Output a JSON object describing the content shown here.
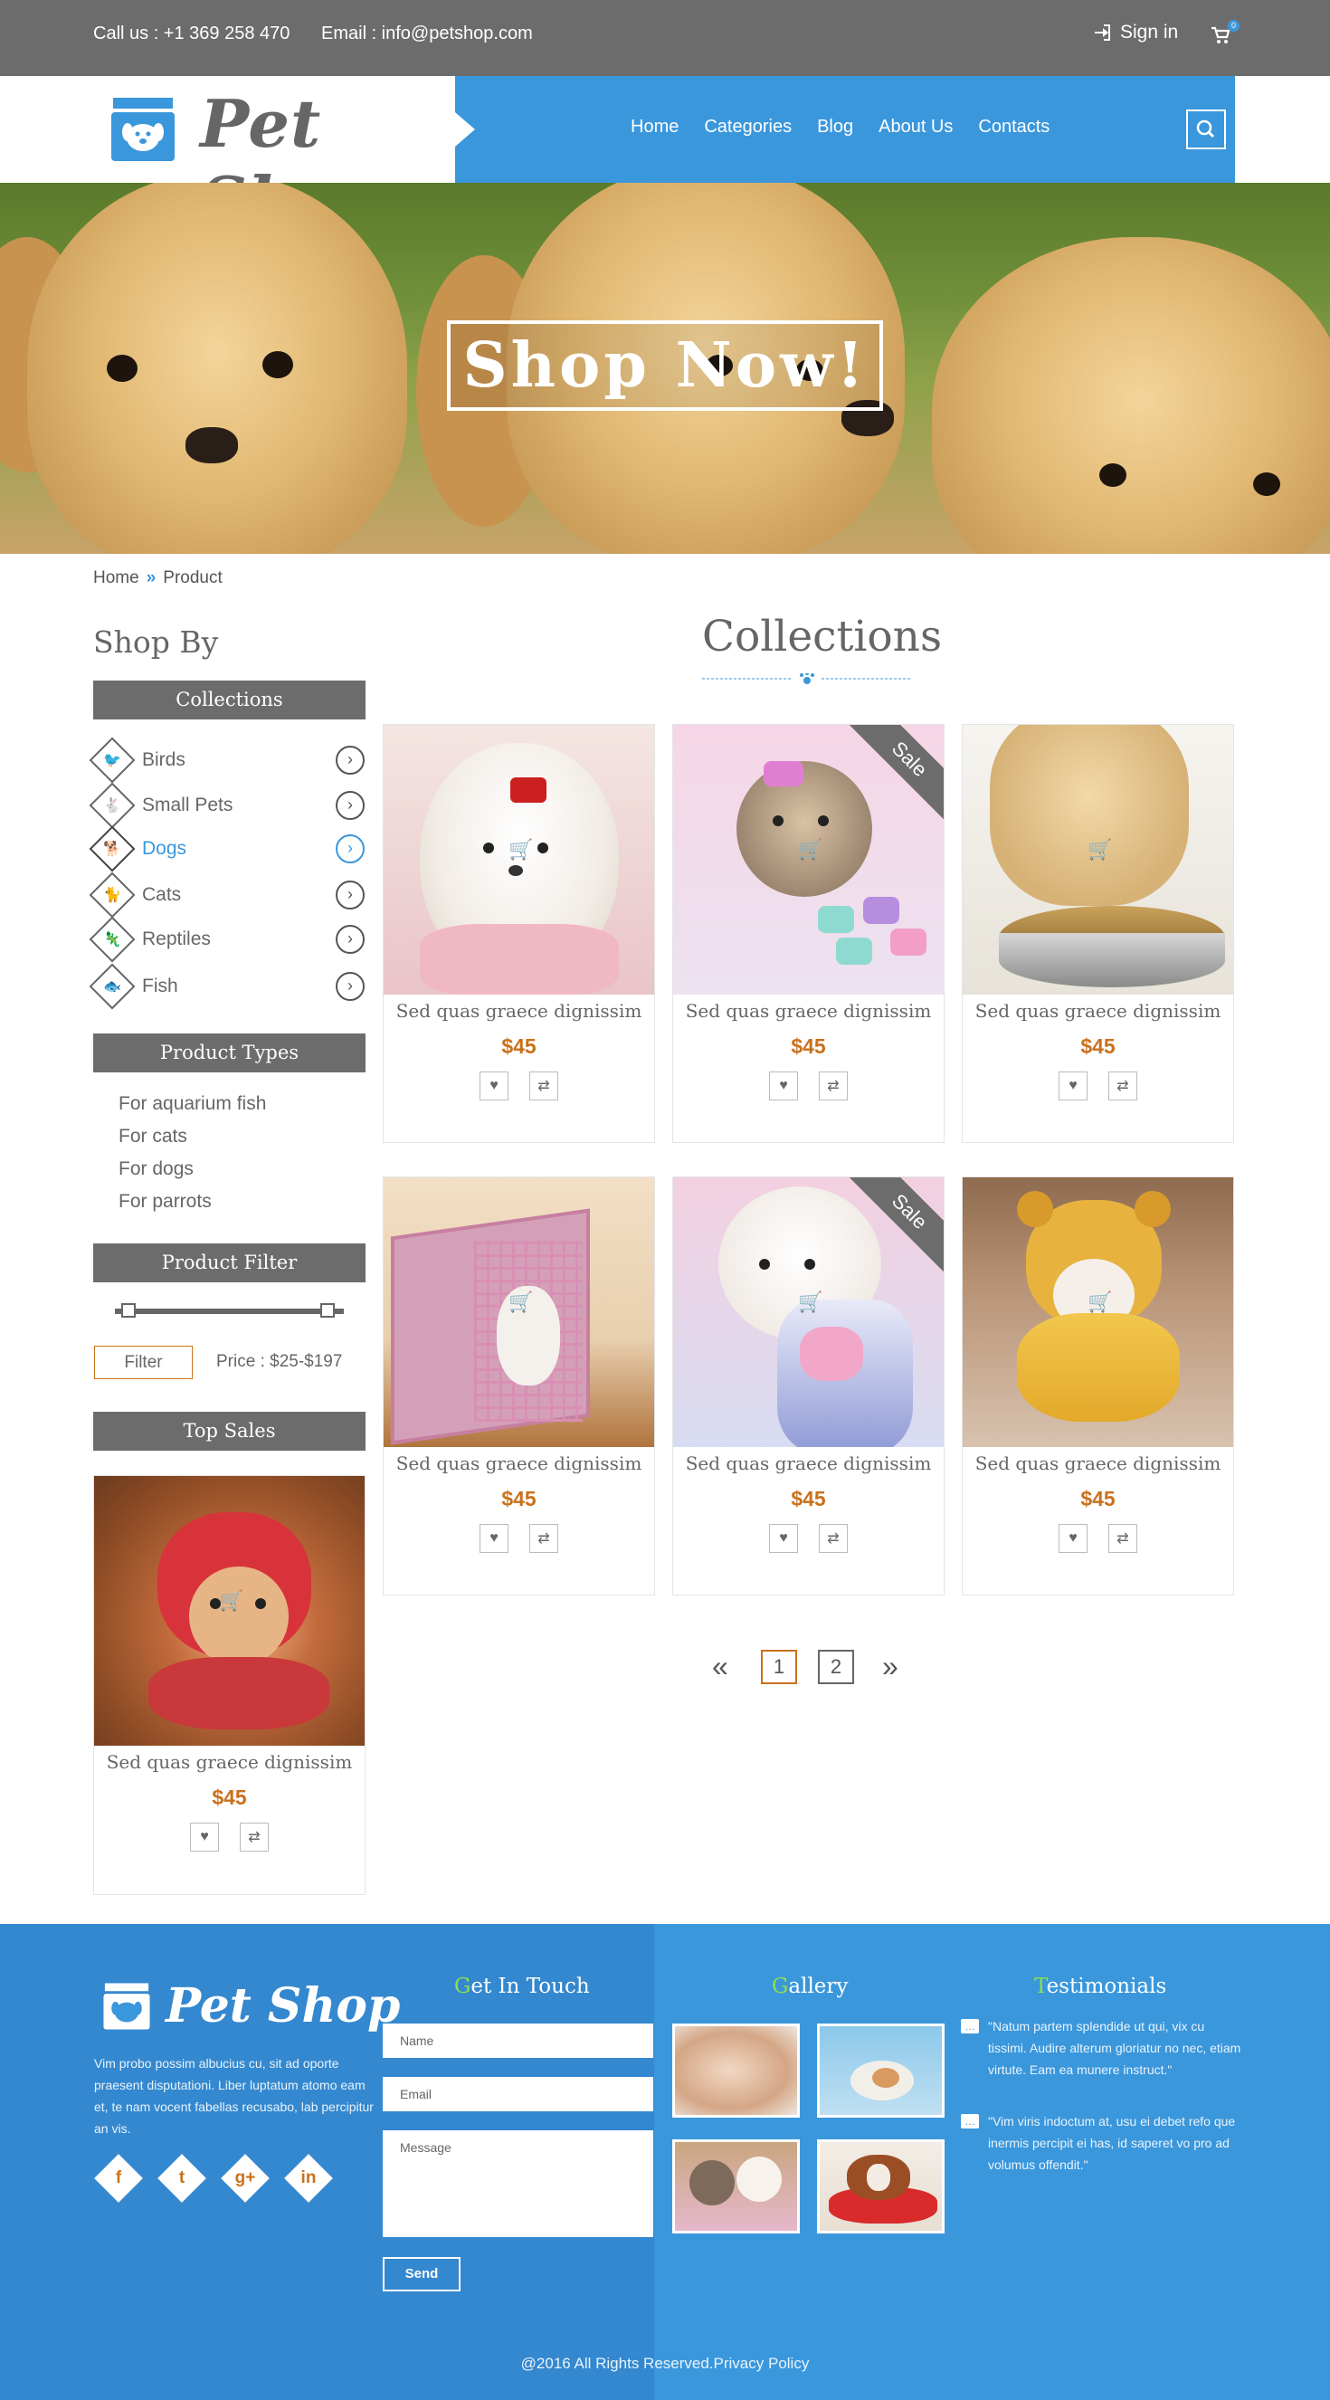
{
  "topbar": {
    "phone": "Call us  : +1 369 258 470",
    "email": "Email : info@petshop.com",
    "signin": "Sign in",
    "cart_count": "0"
  },
  "header": {
    "logo_text": "Pet Shop",
    "nav": [
      "Home",
      "Categories",
      "Blog",
      "About Us",
      "Contacts"
    ]
  },
  "hero": {
    "cta": "Shop Now!"
  },
  "breadcrumb": [
    "Home",
    "Product"
  ],
  "sidebar": {
    "shop_by": "Shop By",
    "collections_title": "Collections",
    "categories": [
      {
        "label": "Birds",
        "icon": "bird-icon"
      },
      {
        "label": "Small Pets",
        "icon": "small-pet-icon"
      },
      {
        "label": "Dogs",
        "icon": "dog-icon"
      },
      {
        "label": "Cats",
        "icon": "cat-icon"
      },
      {
        "label": "Reptiles",
        "icon": "reptile-icon"
      },
      {
        "label": "Fish",
        "icon": "fish-icon"
      }
    ],
    "active_category": "Dogs",
    "product_types_title": "Product Types",
    "product_types": [
      "For aquarium fish",
      "For cats",
      "For dogs",
      "For parrots"
    ],
    "filter_title": "Product Filter",
    "filter_button": "Filter",
    "price_range": "Price : $25-$197",
    "top_sales_title": "Top Sales",
    "top_sale": {
      "name": "Sed quas graece dignissim",
      "price": "$45"
    }
  },
  "collections": {
    "title": "Collections",
    "products": [
      {
        "name": "Sed quas graece dignissim",
        "price": "$45",
        "sale": false
      },
      {
        "name": "Sed quas graece dignissim",
        "price": "$45",
        "sale": true,
        "sale_label": "Sale"
      },
      {
        "name": "Sed quas graece dignissim",
        "price": "$45",
        "sale": false
      },
      {
        "name": "Sed quas graece dignissim",
        "price": "$45",
        "sale": false
      },
      {
        "name": "Sed quas graece dignissim",
        "price": "$45",
        "sale": true,
        "sale_label": "Sale"
      },
      {
        "name": "Sed quas graece dignissim",
        "price": "$45",
        "sale": false
      }
    ]
  },
  "pagination": {
    "pages": [
      "1",
      "2"
    ],
    "current": "1"
  },
  "footer": {
    "logo_text": "Pet Shop",
    "description": "Vim probo possim albucius cu, sit ad oporte praesent disputationi. Liber luptatum atomo eam et, te nam vocent fabellas recusabo, lab percipitur an vis.",
    "get_in_touch_first": "G",
    "get_in_touch_rest": "et In Touch",
    "gallery_first": "G",
    "gallery_rest": "allery",
    "testimonials_first": "T",
    "testimonials_rest": "estimonials",
    "form": {
      "name": "Name",
      "email": "Email",
      "message": "Message",
      "send": "Send"
    },
    "testimonials": [
      "\"Natum partem splendide ut qui, vix cu tissimi. Audire alterum gloriatur no nec, etiam virtute. Eam ea munere instruct.\"",
      "\"Vim viris indoctum at, usu ei debet refo que inermis percipit ei has, id saperet vo pro ad volumus offendit.\""
    ],
    "social": [
      "f",
      "t",
      "g+",
      "in"
    ],
    "copyright": "@2016 All Rights Reserved.Privacy Policy"
  },
  "colors": {
    "accent": "#3a97dc",
    "price": "#c9711c",
    "dark_bar": "#6c6c6c",
    "footer_highlight": "#8de04a"
  }
}
